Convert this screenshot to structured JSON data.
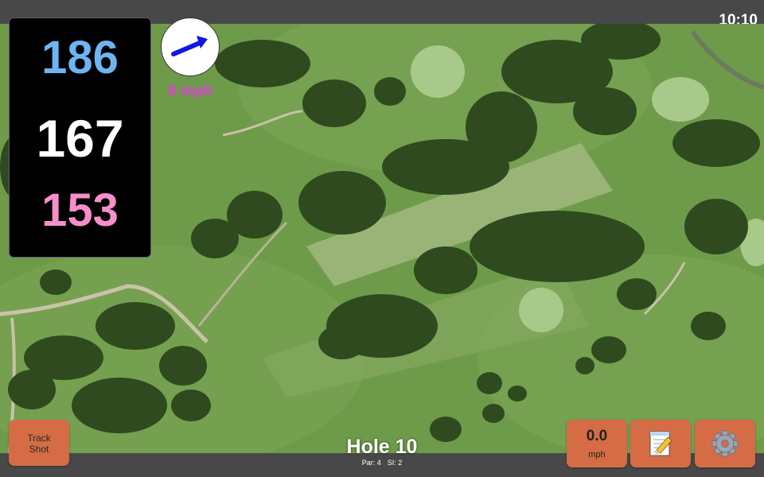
{
  "status_bar": {
    "clock": "10:10"
  },
  "distances": {
    "back": "186",
    "middle": "167",
    "front": "153",
    "colors": {
      "back": "#6fb4f2",
      "middle": "#ffffff",
      "front": "#f58ecb"
    }
  },
  "wind": {
    "speed_label": "8 mph",
    "label_color": "#e040d8",
    "arrow_color": "#1017e0",
    "arrow_icon": "arrow-right-up-icon"
  },
  "track_shot": {
    "label": "Track\nShot"
  },
  "shot_speed": {
    "value": "0.0",
    "unit": "mph"
  },
  "notes": {
    "icon": "notepad-pencil-icon"
  },
  "settings": {
    "icon": "gear-icon"
  },
  "hole": {
    "title": "Hole 10",
    "par": "Par: 4",
    "si": "SI: 2"
  },
  "colors": {
    "button": "#d56c45",
    "panel": "#000000",
    "bars": "#484848"
  }
}
